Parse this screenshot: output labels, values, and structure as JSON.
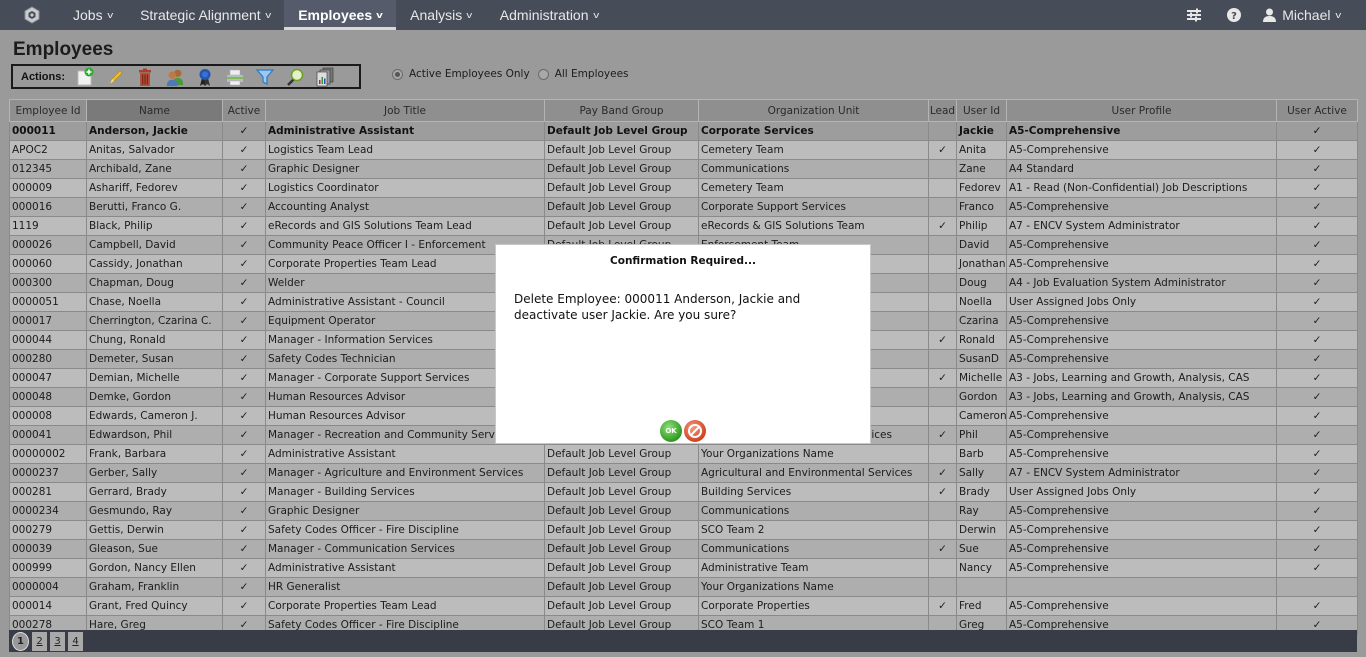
{
  "nav": {
    "items": [
      {
        "label": "Jobs",
        "active": false
      },
      {
        "label": "Strategic Alignment",
        "active": false
      },
      {
        "label": "Employees",
        "active": true
      },
      {
        "label": "Analysis",
        "active": false
      },
      {
        "label": "Administration",
        "active": false
      }
    ],
    "user": "Michael",
    "icons": [
      "settings-sliders-icon",
      "help-icon",
      "user-icon"
    ]
  },
  "page": {
    "title": "Employees",
    "actions_label": "Actions:",
    "actions": [
      {
        "name": "add-employee",
        "icon": "add-document-icon"
      },
      {
        "name": "edit",
        "icon": "pencil-icon"
      },
      {
        "name": "delete",
        "icon": "trash-icon"
      },
      {
        "name": "users",
        "icon": "users-icon"
      },
      {
        "name": "award",
        "icon": "ribbon-icon"
      },
      {
        "name": "print",
        "icon": "printer-icon"
      },
      {
        "name": "filter",
        "icon": "funnel-icon"
      },
      {
        "name": "search",
        "icon": "magnifier-icon"
      },
      {
        "name": "reports",
        "icon": "reports-icon"
      }
    ],
    "filters": {
      "options": [
        "Active Employees Only",
        "All Employees"
      ],
      "selected": "Active Employees Only"
    }
  },
  "table": {
    "columns": [
      "Employee Id",
      "Name",
      "Active",
      "Job Title",
      "Pay Band Group",
      "Organization Unit",
      "Lead",
      "User Id",
      "User Profile",
      "User Active"
    ],
    "sorted_column": "Name",
    "check": "✓",
    "rows": [
      {
        "id": "000011",
        "name": "Anderson, Jackie",
        "active": true,
        "job": "Administrative Assistant",
        "pay": "Default Job Level Group",
        "org": "Corporate Services",
        "lead": false,
        "user": "Jackie",
        "profile": "A5-Comprehensive",
        "uactive": true,
        "selected": true
      },
      {
        "id": "APOC2",
        "name": "Anitas, Salvador",
        "active": true,
        "job": "Logistics Team Lead",
        "pay": "Default Job Level Group",
        "org": "Cemetery Team",
        "lead": true,
        "user": "Anita",
        "profile": "A5-Comprehensive",
        "uactive": true
      },
      {
        "id": "012345",
        "name": "Archibald, Zane",
        "active": true,
        "job": "Graphic Designer",
        "pay": "Default Job Level Group",
        "org": "Communications",
        "lead": false,
        "user": "Zane",
        "profile": "A4 Standard",
        "uactive": true
      },
      {
        "id": "000009",
        "name": "Ashariff, Fedorev",
        "active": true,
        "job": "Logistics Coordinator",
        "pay": "Default Job Level Group",
        "org": "Cemetery Team",
        "lead": false,
        "user": "Fedorev",
        "profile": "A1 - Read (Non-Confidential) Job Descriptions",
        "uactive": true
      },
      {
        "id": "000016",
        "name": "Berutti, Franco G.",
        "active": true,
        "job": "Accounting Analyst",
        "pay": "Default Job Level Group",
        "org": "Corporate Support Services",
        "lead": false,
        "user": "Franco",
        "profile": "A5-Comprehensive",
        "uactive": true
      },
      {
        "id": "1119",
        "name": "Black, Philip",
        "active": true,
        "job": "eRecords and GIS Solutions Team Lead",
        "pay": "Default Job Level Group",
        "org": "eRecords & GIS Solutions Team",
        "lead": true,
        "user": "Philip",
        "profile": "A7 - ENCV System Administrator",
        "uactive": true
      },
      {
        "id": "000026",
        "name": "Campbell, David",
        "active": true,
        "job": "Community Peace Officer I - Enforcement",
        "pay": "Default Job Level Group",
        "org": "Enforcement Team",
        "lead": false,
        "user": "David",
        "profile": "A5-Comprehensive",
        "uactive": true
      },
      {
        "id": "000060",
        "name": "Cassidy, Jonathan",
        "active": true,
        "job": "Corporate Properties Team Lead",
        "pay": "",
        "org": "",
        "lead": false,
        "user": "Jonathan",
        "profile": "A5-Comprehensive",
        "uactive": true
      },
      {
        "id": "000300",
        "name": "Chapman, Doug",
        "active": true,
        "job": "Welder",
        "pay": "",
        "org": "",
        "lead": false,
        "user": "Doug",
        "profile": "A4 - Job Evaluation System Administrator",
        "uactive": true
      },
      {
        "id": "0000051",
        "name": "Chase, Noella",
        "active": true,
        "job": "Administrative Assistant - Council",
        "pay": "",
        "org": "",
        "lead": false,
        "user": "Noella",
        "profile": "User Assigned Jobs Only",
        "uactive": true
      },
      {
        "id": "000017",
        "name": "Cherrington, Czarina C.",
        "active": true,
        "job": "Equipment Operator",
        "pay": "",
        "org": "",
        "lead": false,
        "user": "Czarina",
        "profile": "A5-Comprehensive",
        "uactive": true
      },
      {
        "id": "000044",
        "name": "Chung, Ronald",
        "active": true,
        "job": "Manager - Information Services",
        "pay": "",
        "org": "",
        "lead": true,
        "user": "Ronald",
        "profile": "A5-Comprehensive",
        "uactive": true
      },
      {
        "id": "000280",
        "name": "Demeter, Susan",
        "active": true,
        "job": "Safety Codes Technician",
        "pay": "",
        "org": "",
        "lead": false,
        "user": "SusanD",
        "profile": "A5-Comprehensive",
        "uactive": true
      },
      {
        "id": "000047",
        "name": "Demian, Michelle",
        "active": true,
        "job": "Manager - Corporate Support Services",
        "pay": "",
        "org": "",
        "lead": true,
        "user": "Michelle",
        "profile": "A3 - Jobs, Learning and Growth, Analysis, CAS",
        "uactive": true
      },
      {
        "id": "000048",
        "name": "Demke, Gordon",
        "active": true,
        "job": "Human Resources Advisor",
        "pay": "",
        "org": "",
        "lead": false,
        "user": "Gordon",
        "profile": "A3 - Jobs, Learning and Growth, Analysis, CAS",
        "uactive": true
      },
      {
        "id": "000008",
        "name": "Edwards, Cameron J.",
        "active": true,
        "job": "Human Resources Advisor",
        "pay": "",
        "org": "",
        "lead": false,
        "user": "Cameron",
        "profile": "A5-Comprehensive",
        "uactive": true
      },
      {
        "id": "000041",
        "name": "Edwardson, Phil",
        "active": true,
        "job": "Manager - Recreation and Community Services",
        "pay": "",
        "org": "Recreation and Community Services",
        "lead": true,
        "user": "Phil",
        "profile": "A5-Comprehensive",
        "uactive": true
      },
      {
        "id": "00000002",
        "name": "Frank, Barbara",
        "active": true,
        "job": "Administrative Assistant",
        "pay": "Default Job Level Group",
        "org": "Your Organizations Name",
        "lead": false,
        "user": "Barb",
        "profile": "A5-Comprehensive",
        "uactive": true
      },
      {
        "id": "0000237",
        "name": "Gerber, Sally",
        "active": true,
        "job": "Manager - Agriculture and Environment Services",
        "pay": "Default Job Level Group",
        "org": "Agricultural and Environmental Services",
        "lead": true,
        "user": "Sally",
        "profile": "A7 - ENCV System Administrator",
        "uactive": true
      },
      {
        "id": "000281",
        "name": "Gerrard, Brady",
        "active": true,
        "job": "Manager - Building Services",
        "pay": "Default Job Level Group",
        "org": "Building Services",
        "lead": true,
        "user": "Brady",
        "profile": "User Assigned Jobs Only",
        "uactive": true
      },
      {
        "id": "0000234",
        "name": "Gesmundo, Ray",
        "active": true,
        "job": "Graphic Designer",
        "pay": "Default Job Level Group",
        "org": "Communications",
        "lead": false,
        "user": "Ray",
        "profile": "A5-Comprehensive",
        "uactive": true
      },
      {
        "id": "000279",
        "name": "Gettis, Derwin",
        "active": true,
        "job": "Safety Codes Officer - Fire Discipline",
        "pay": "Default Job Level Group",
        "org": "SCO Team 2",
        "lead": false,
        "user": "Derwin",
        "profile": "A5-Comprehensive",
        "uactive": true
      },
      {
        "id": "000039",
        "name": "Gleason, Sue",
        "active": true,
        "job": "Manager - Communication Services",
        "pay": "Default Job Level Group",
        "org": "Communications",
        "lead": true,
        "user": "Sue",
        "profile": "A5-Comprehensive",
        "uactive": true
      },
      {
        "id": "000999",
        "name": "Gordon, Nancy Ellen",
        "active": true,
        "job": "Administrative Assistant",
        "pay": "Default Job Level Group",
        "org": "Administrative Team",
        "lead": false,
        "user": "Nancy",
        "profile": "A5-Comprehensive",
        "uactive": true
      },
      {
        "id": "0000004",
        "name": "Graham, Franklin",
        "active": true,
        "job": "HR Generalist",
        "pay": "Default Job Level Group",
        "org": "Your Organizations Name",
        "lead": false,
        "user": "",
        "profile": "",
        "uactive": false
      },
      {
        "id": "000014",
        "name": "Grant, Fred Quincy",
        "active": true,
        "job": "Corporate Properties Team Lead",
        "pay": "Default Job Level Group",
        "org": "Corporate Properties",
        "lead": true,
        "user": "Fred",
        "profile": "A5-Comprehensive",
        "uactive": true
      },
      {
        "id": "000278",
        "name": "Hare, Greg",
        "active": true,
        "job": "Safety Codes Officer - Fire Discipline",
        "pay": "Default Job Level Group",
        "org": "SCO Team 1",
        "lead": false,
        "user": "Greg",
        "profile": "A5-Comprehensive",
        "uactive": true
      }
    ]
  },
  "pager": {
    "pages": [
      "1",
      "2",
      "3",
      "4"
    ],
    "current": "1"
  },
  "modal": {
    "title": "Confirmation Required...",
    "message": "Delete Employee: 000011 Anderson, Jackie and deactivate user Jackie. Are you sure?",
    "ok_label": "OK",
    "ok_icon": "ok-icon",
    "cancel_icon": "cancel-icon"
  }
}
